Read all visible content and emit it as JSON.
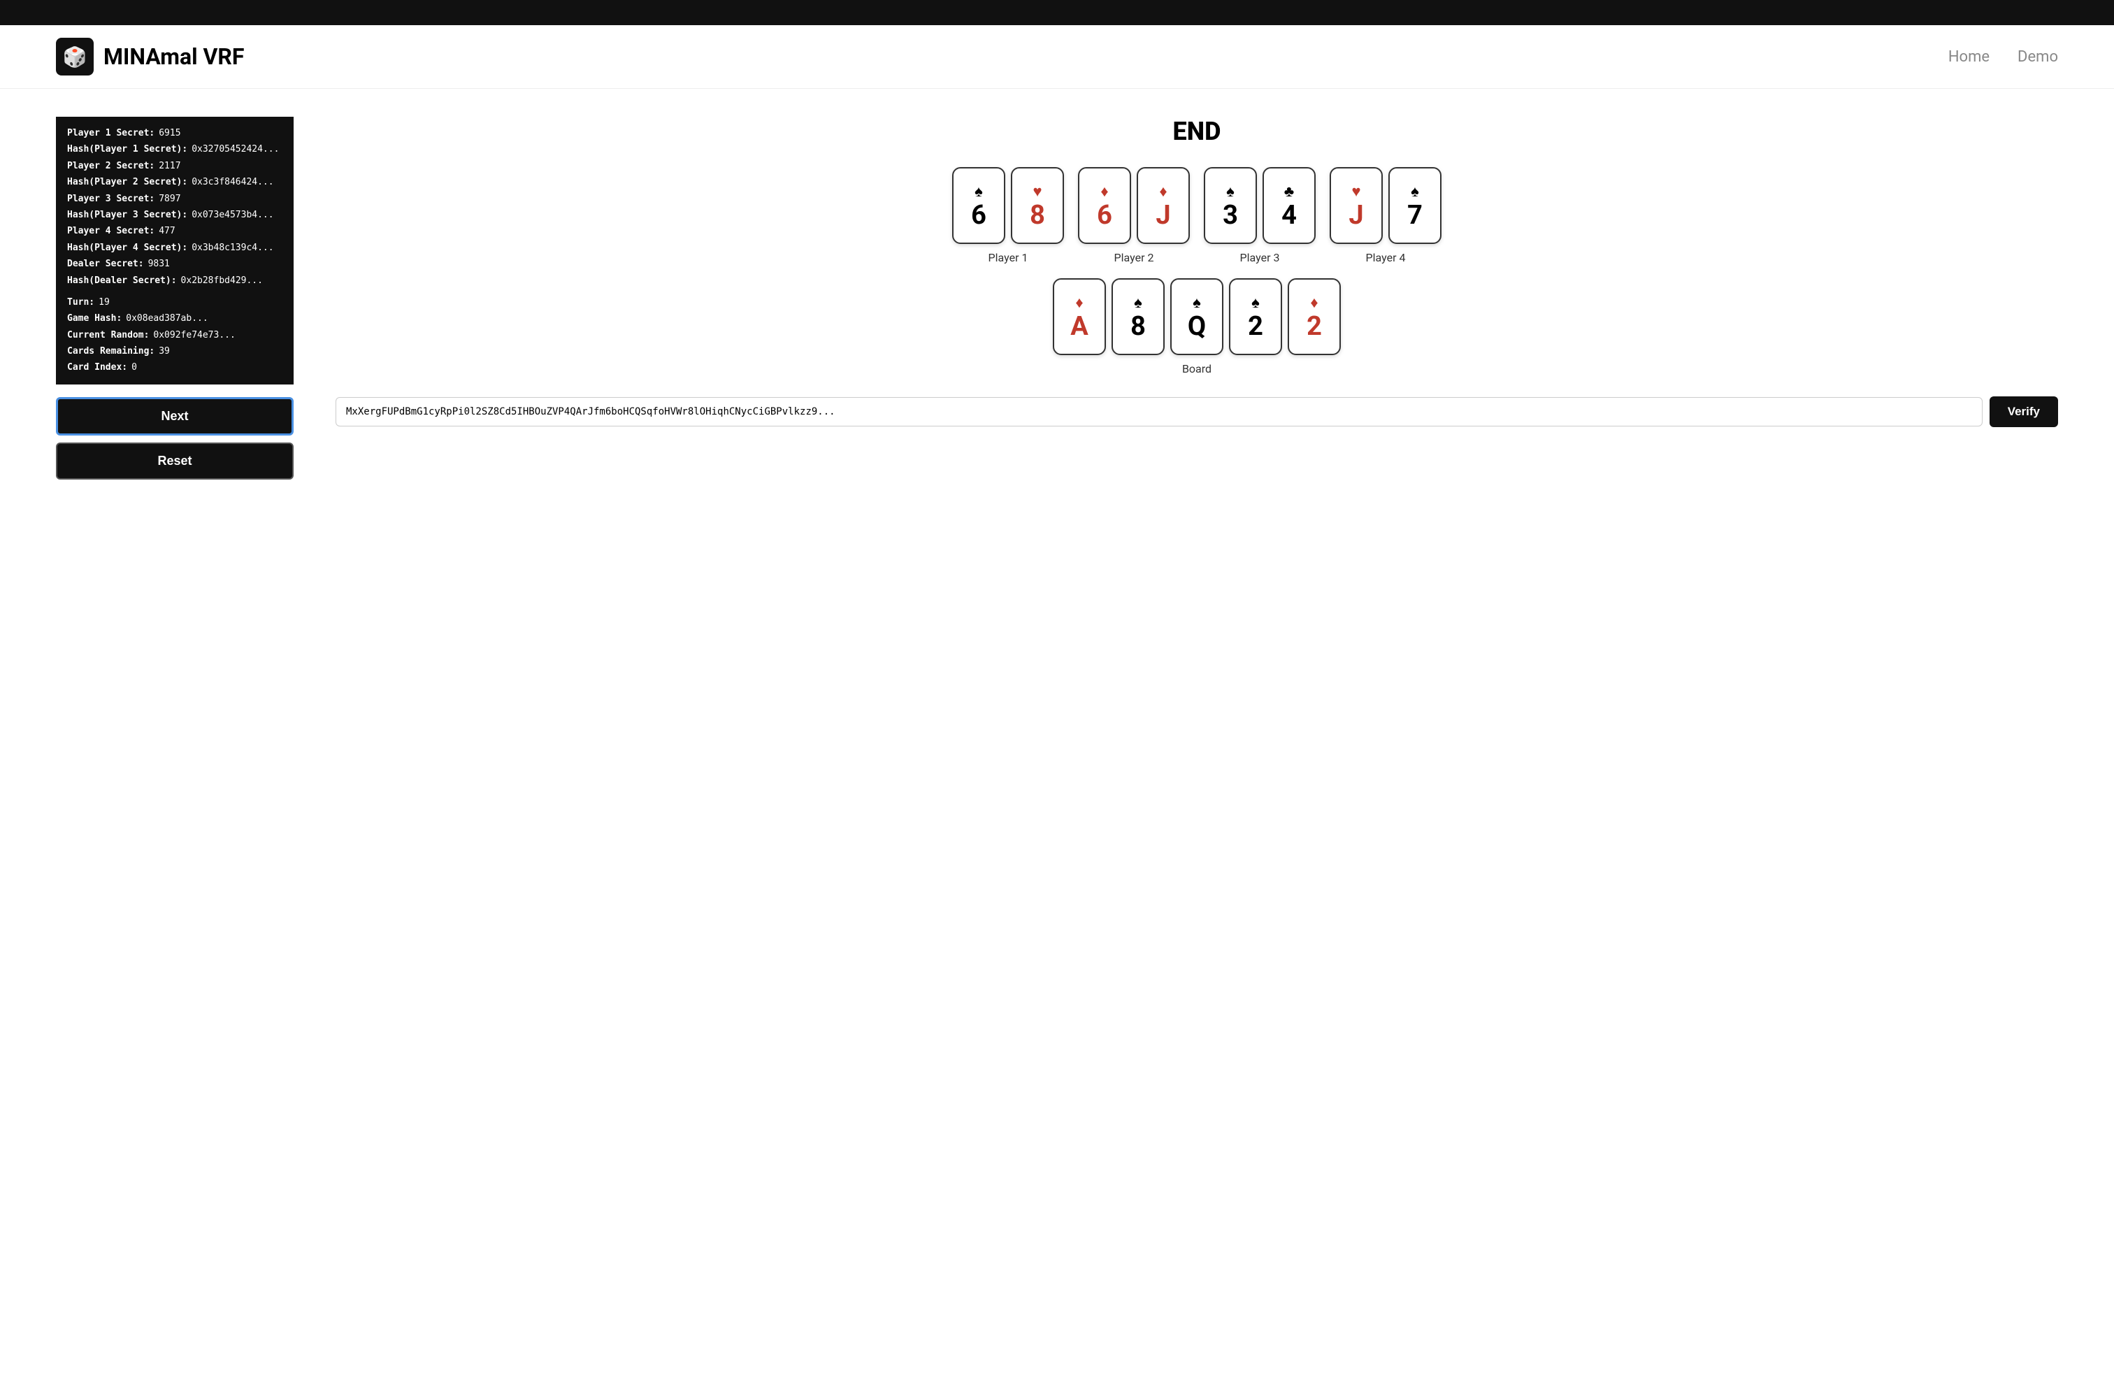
{
  "topbar": {},
  "navbar": {
    "brand": "MINAmal VRF",
    "logo": "🎲",
    "links": [
      {
        "label": "Home",
        "id": "home"
      },
      {
        "label": "Demo",
        "id": "demo"
      }
    ]
  },
  "left_panel": {
    "rows": [
      {
        "label": "Player 1 Secret:",
        "value": "6915"
      },
      {
        "label": "Hash(Player 1 Secret):",
        "value": "0x32705452424..."
      },
      {
        "label": "Player 2 Secret:",
        "value": "2117"
      },
      {
        "label": "Hash(Player 2 Secret):",
        "value": "0x3c3f846424..."
      },
      {
        "label": "Player 3 Secret:",
        "value": "7897"
      },
      {
        "label": "Hash(Player 3 Secret):",
        "value": "0x073e4573b4..."
      },
      {
        "label": "Player 4 Secret:",
        "value": "477"
      },
      {
        "label": "Hash(Player 4 Secret):",
        "value": "0x3b48c139c4..."
      },
      {
        "label": "Dealer Secret:",
        "value": "9831"
      },
      {
        "label": "Hash(Dealer Secret):",
        "value": "0x2b28fbd429..."
      }
    ],
    "stats": [
      {
        "label": "Turn:",
        "value": "19"
      },
      {
        "label": "Game Hash:",
        "value": "0x08ead387ab..."
      },
      {
        "label": "Current Random:",
        "value": "0x092fe74e73..."
      },
      {
        "label": "Cards Remaining:",
        "value": "39"
      },
      {
        "label": "Card Index:",
        "value": "0"
      }
    ],
    "btn_next": "Next",
    "btn_reset": "Reset"
  },
  "right_panel": {
    "title": "END",
    "players": [
      {
        "label": "Player 1",
        "cards": [
          {
            "value": "6",
            "suit": "♠",
            "color": "black"
          },
          {
            "value": "8",
            "suit": "♥",
            "color": "red"
          }
        ]
      },
      {
        "label": "Player 2",
        "cards": [
          {
            "value": "6",
            "suit": "♦",
            "color": "red"
          },
          {
            "value": "J",
            "suit": "♦",
            "color": "red"
          }
        ]
      },
      {
        "label": "Player 3",
        "cards": [
          {
            "value": "3",
            "suit": "♠",
            "color": "black"
          },
          {
            "value": "4",
            "suit": "♣",
            "color": "black"
          }
        ]
      },
      {
        "label": "Player 4",
        "cards": [
          {
            "value": "J",
            "suit": "♥",
            "color": "red"
          },
          {
            "value": "7",
            "suit": "♠",
            "color": "black"
          }
        ]
      }
    ],
    "board": {
      "label": "Board",
      "cards": [
        {
          "value": "A",
          "suit": "♦",
          "color": "red"
        },
        {
          "value": "8",
          "suit": "♠",
          "color": "black"
        },
        {
          "value": "Q",
          "suit": "♠",
          "color": "black"
        },
        {
          "value": "2",
          "suit": "♠",
          "color": "black"
        },
        {
          "value": "2",
          "suit": "♦",
          "color": "red"
        }
      ]
    },
    "verify_placeholder": "MxXergFUPdBmG1cyRpPi0l2SZ8Cd5IHBOuZVP4QArJfm6boHCQSqfoHVWr8lOHiqhCNycCiGBPvlkzz9...",
    "verify_btn": "Verify"
  }
}
